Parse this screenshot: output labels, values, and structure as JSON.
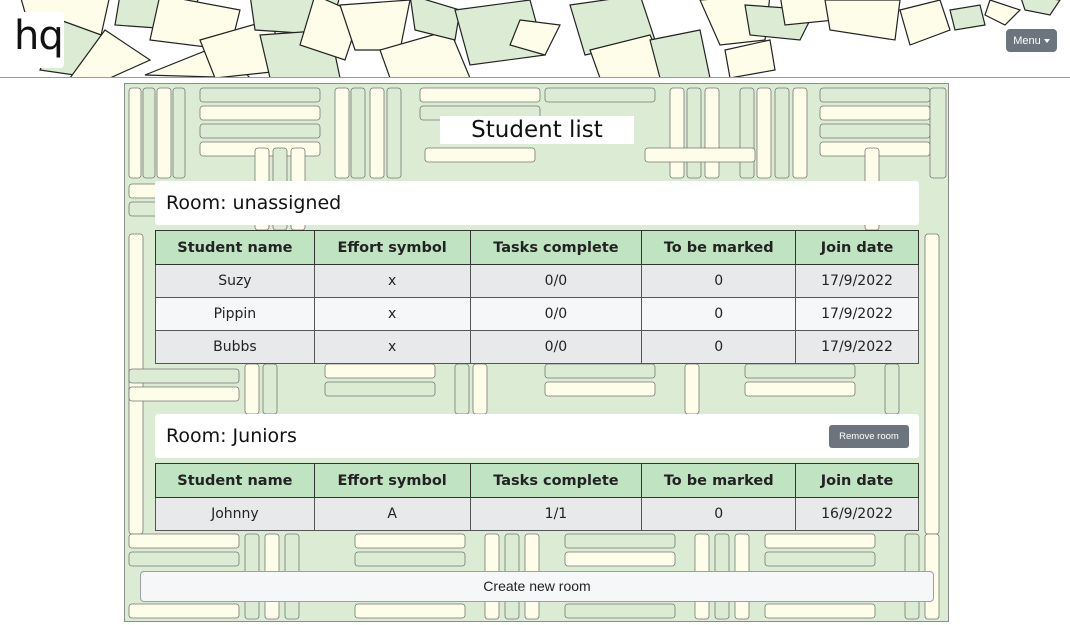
{
  "header": {
    "logo_text": "hq",
    "menu_label": "Menu"
  },
  "page": {
    "title": "Student list"
  },
  "columns": [
    "Student name",
    "Effort symbol",
    "Tasks complete",
    "To be marked",
    "Join date"
  ],
  "rooms": [
    {
      "label": "Room: unassigned",
      "students": [
        {
          "name": "Suzy",
          "effort": "x",
          "tasks": "0/0",
          "to_mark": "0",
          "joined": "17/9/2022"
        },
        {
          "name": "Pippin",
          "effort": "x",
          "tasks": "0/0",
          "to_mark": "0",
          "joined": "17/9/2022"
        },
        {
          "name": "Bubbs",
          "effort": "x",
          "tasks": "0/0",
          "to_mark": "0",
          "joined": "17/9/2022"
        }
      ]
    },
    {
      "label": "Room: Juniors",
      "remove_label": "Remove room",
      "students": [
        {
          "name": "Johnny",
          "effort": "A",
          "tasks": "1/1",
          "to_mark": "0",
          "joined": "16/9/2022"
        }
      ]
    }
  ],
  "actions": {
    "create_room_label": "Create new room"
  },
  "colors": {
    "header_accent": "#dcecd4",
    "table_header": "#c0e3c1",
    "button_gray": "#6c757d"
  }
}
